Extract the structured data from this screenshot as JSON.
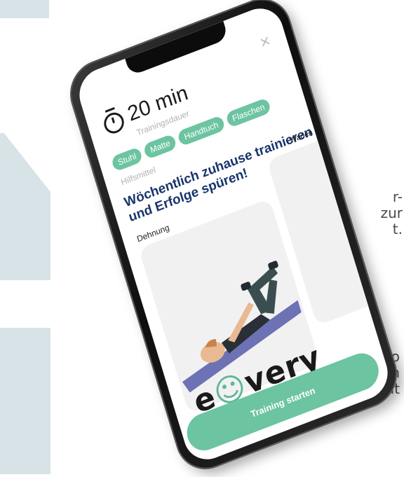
{
  "background_text": {
    "middle": "r-\nzur\nt.",
    "bottom": "o\nen\nnit"
  },
  "app": {
    "close_label": "×",
    "duration": "20 min",
    "duration_caption": "Trainingsdauer",
    "equipment": [
      "Stuhl",
      "Matte",
      "Handtuch",
      "Flaschen"
    ],
    "equipment_caption": "Hilfsmittel",
    "headline": "Wöchentlich zuhause trainieren und Erfolge spüren!",
    "exercise_1": "Dehnung",
    "exercise_2": "Waden",
    "logo_text_before": "e",
    "logo_text_after": "very",
    "start_button": "Training starten"
  },
  "colors": {
    "accent": "#6cc4a1",
    "headline": "#17346b",
    "panel": "#d7e3e6"
  }
}
